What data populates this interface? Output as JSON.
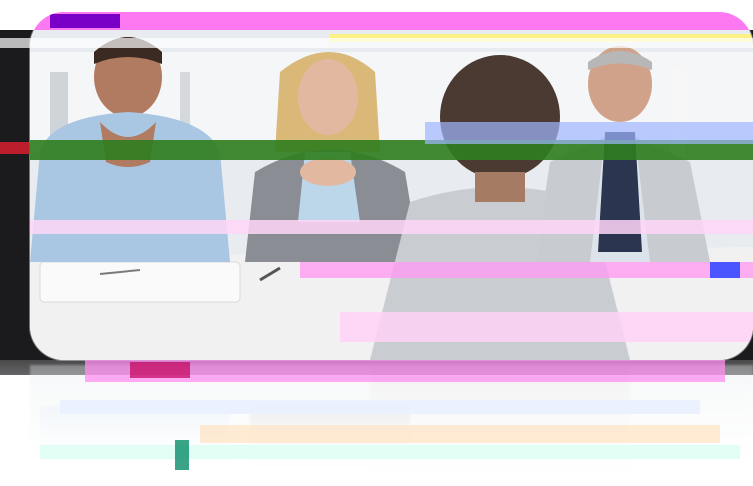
{
  "image": {
    "subject": "job-interview-scene",
    "colors": {
      "backdrop": "#1b1b1d",
      "wall": "#e6e9ed",
      "table": "#efefef",
      "shirt_blue": "#a9c6e2",
      "cardigan_grey": "#8a8d93",
      "suit_grey": "#c8ccd0",
      "glitch_magenta": "#ff5cf0",
      "glitch_green": "#2f7d1e",
      "glitch_blue": "#4a55ff"
    }
  }
}
